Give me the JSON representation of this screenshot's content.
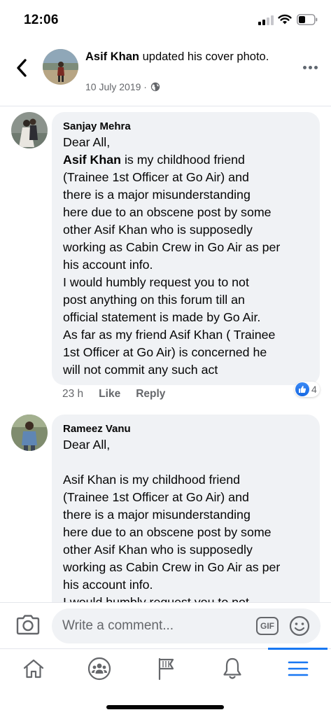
{
  "status_bar": {
    "time": "12:06",
    "icons": [
      "cellular-signal-icon",
      "wifi-icon",
      "battery-icon"
    ]
  },
  "post_header": {
    "author": "Asif Khan",
    "action_text": " updated his cover photo.",
    "date": "10 July 2019 ·",
    "privacy_icon": "globe-icon"
  },
  "comments": [
    {
      "author": "Sanjay Mehra",
      "lines": [
        {
          "bold": "",
          "text": "Dear All,"
        },
        {
          "bold": "Asif Khan",
          "text": " is my childhood friend"
        },
        {
          "bold": "",
          "text": "(Trainee 1st Officer at Go Air) and"
        },
        {
          "bold": "",
          "text": "there is a major misunderstanding"
        },
        {
          "bold": "",
          "text": "here due to an obscene post by some"
        },
        {
          "bold": "",
          "text": "other Asif Khan who is supposedly"
        },
        {
          "bold": "",
          "text": "working as Cabin Crew in Go Air as per"
        },
        {
          "bold": "",
          "text": "his account info."
        },
        {
          "bold": "",
          "text": "I would humbly request you to not"
        },
        {
          "bold": "",
          "text": "post anything on this forum till an"
        },
        {
          "bold": "",
          "text": "official statement is made by Go Air."
        },
        {
          "bold": "",
          "text": "As far as my friend Asif Khan ( Trainee"
        },
        {
          "bold": "",
          "text": "1st Officer at Go  Air) is concerned he"
        },
        {
          "bold": "",
          "text": "will not commit any such act"
        }
      ],
      "time": "23 h",
      "like_label": "Like",
      "reply_label": "Reply",
      "reaction_count": "4"
    },
    {
      "author": "Rameez Vanu",
      "lines": [
        {
          "bold": "",
          "text": "Dear All,"
        },
        {
          "bold": "",
          "text": ""
        },
        {
          "bold": "",
          "text": "Asif Khan is my childhood friend"
        },
        {
          "bold": "",
          "text": "(Trainee 1st Officer at Go Air) and"
        },
        {
          "bold": "",
          "text": "there is a major misunderstanding"
        },
        {
          "bold": "",
          "text": "here due to an obscene post by some"
        },
        {
          "bold": "",
          "text": "other Asif Khan who is supposedly"
        },
        {
          "bold": "",
          "text": "working as Cabin Crew in Go Air as per"
        },
        {
          "bold": "",
          "text": "his account info."
        },
        {
          "bold": "",
          "text": "I would humbly request you to not"
        }
      ]
    }
  ],
  "composer": {
    "placeholder": "Write a comment...",
    "gif_label": "GIF"
  },
  "tab_bar": {
    "tabs": [
      "home-icon",
      "groups-icon",
      "pages-flag-icon",
      "notifications-bell-icon",
      "menu-icon"
    ],
    "active_tab": "menu-icon"
  },
  "colors": {
    "accent": "#1877f2",
    "bubble": "#f0f2f5",
    "secondary_text": "#65676b"
  }
}
